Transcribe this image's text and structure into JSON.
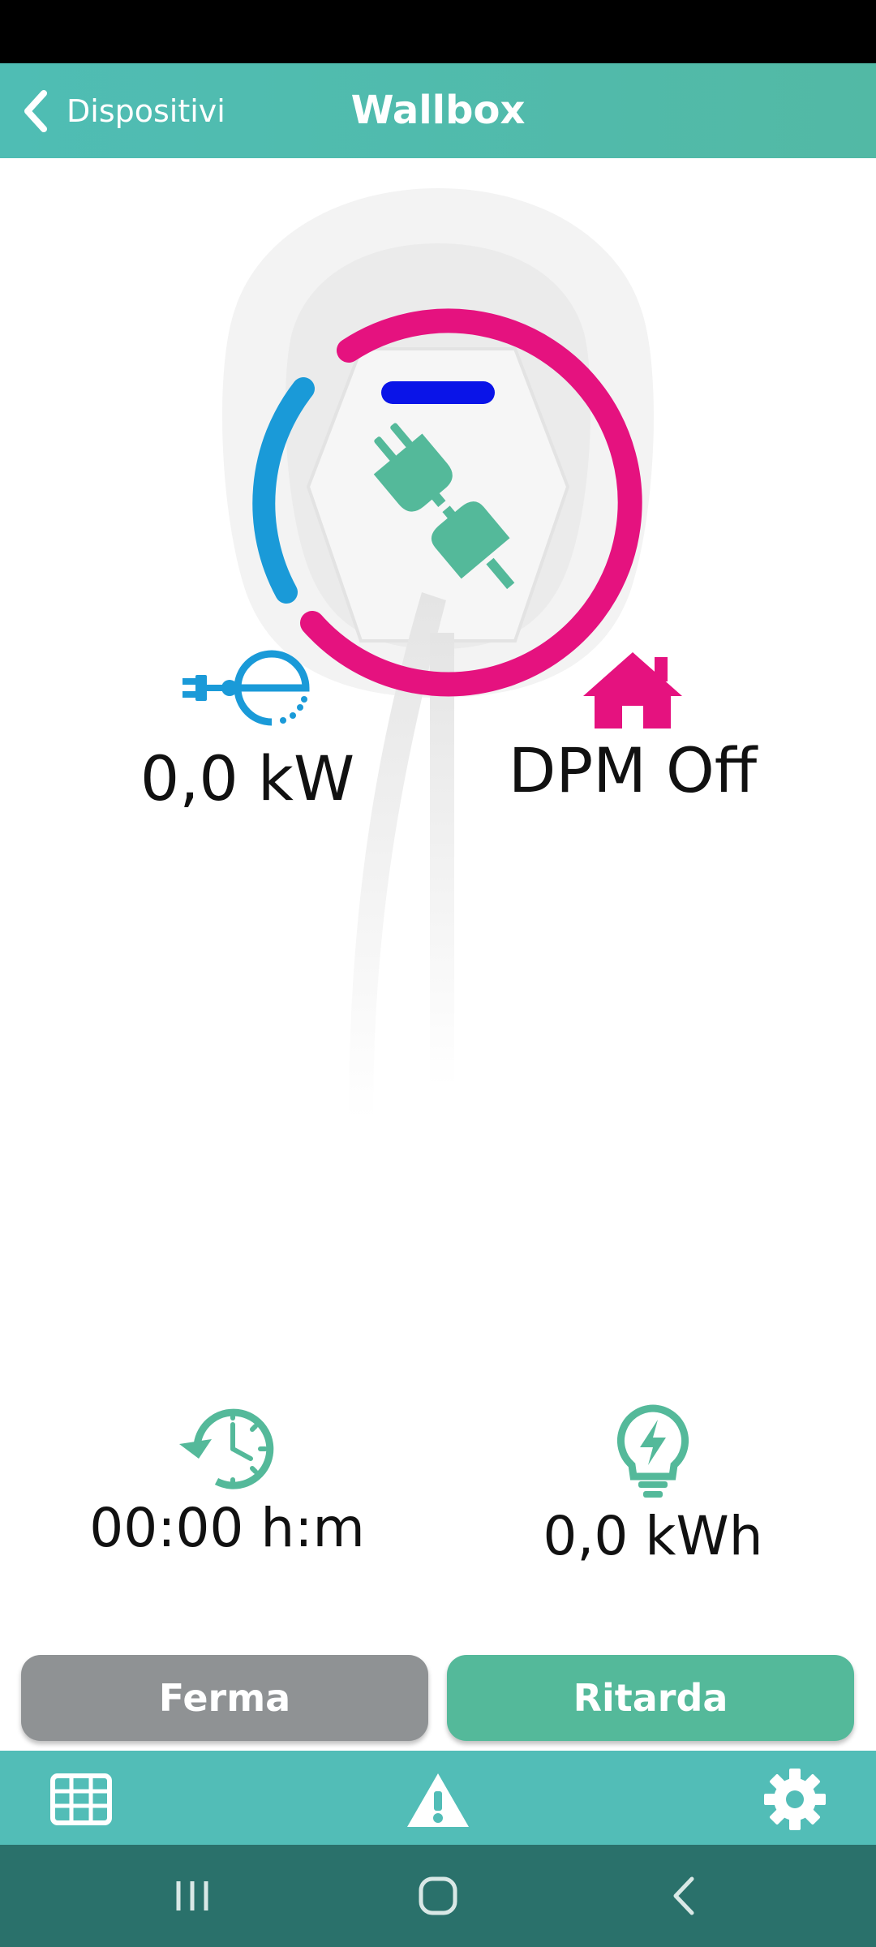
{
  "header": {
    "back_label": "Dispositivi",
    "title": "Wallbox"
  },
  "stats": {
    "power": {
      "value": "0,0 kW",
      "icon": "ev-charging-icon"
    },
    "dpm": {
      "value": "DPM Off",
      "icon": "home-icon"
    },
    "duration": {
      "value": "00:00 h:m",
      "icon": "clock-history-icon"
    },
    "energy": {
      "value": "0,0 kWh",
      "icon": "bulb-bolt-icon"
    }
  },
  "actions": {
    "stop_label": "Ferma",
    "delay_label": "Ritarda"
  },
  "tabbar": {
    "icons": [
      "grid-icon",
      "warning-icon",
      "gear-icon"
    ]
  },
  "colors": {
    "accent": "#52bdb7",
    "green": "#54b99a",
    "pink": "#e5127f",
    "blue": "#1a9ad8",
    "gray_button": "#8f9294",
    "nav_bg": "#2a716b"
  }
}
